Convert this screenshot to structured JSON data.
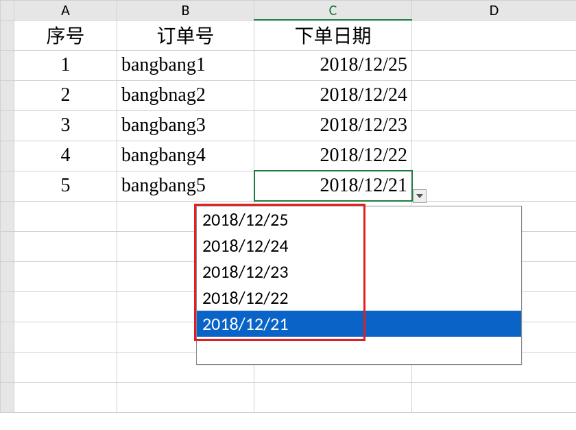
{
  "columns": {
    "A": "A",
    "B": "B",
    "C": "C",
    "D": "D"
  },
  "header": {
    "A": "序号",
    "B": "订单号",
    "C": "下单日期"
  },
  "rows": [
    {
      "A": "1",
      "B": "bangbang1",
      "C": "2018/12/25"
    },
    {
      "A": "2",
      "B": "bangbnag2",
      "C": "2018/12/24"
    },
    {
      "A": "3",
      "B": "bangbang3",
      "C": "2018/12/23"
    },
    {
      "A": "4",
      "B": "bangbang4",
      "C": "2018/12/22"
    },
    {
      "A": "5",
      "B": "bangbang5",
      "C": "2018/12/21"
    }
  ],
  "dropdown": {
    "options": [
      "2018/12/25",
      "2018/12/24",
      "2018/12/23",
      "2018/12/22",
      "2018/12/21"
    ],
    "selected_index": 4
  }
}
